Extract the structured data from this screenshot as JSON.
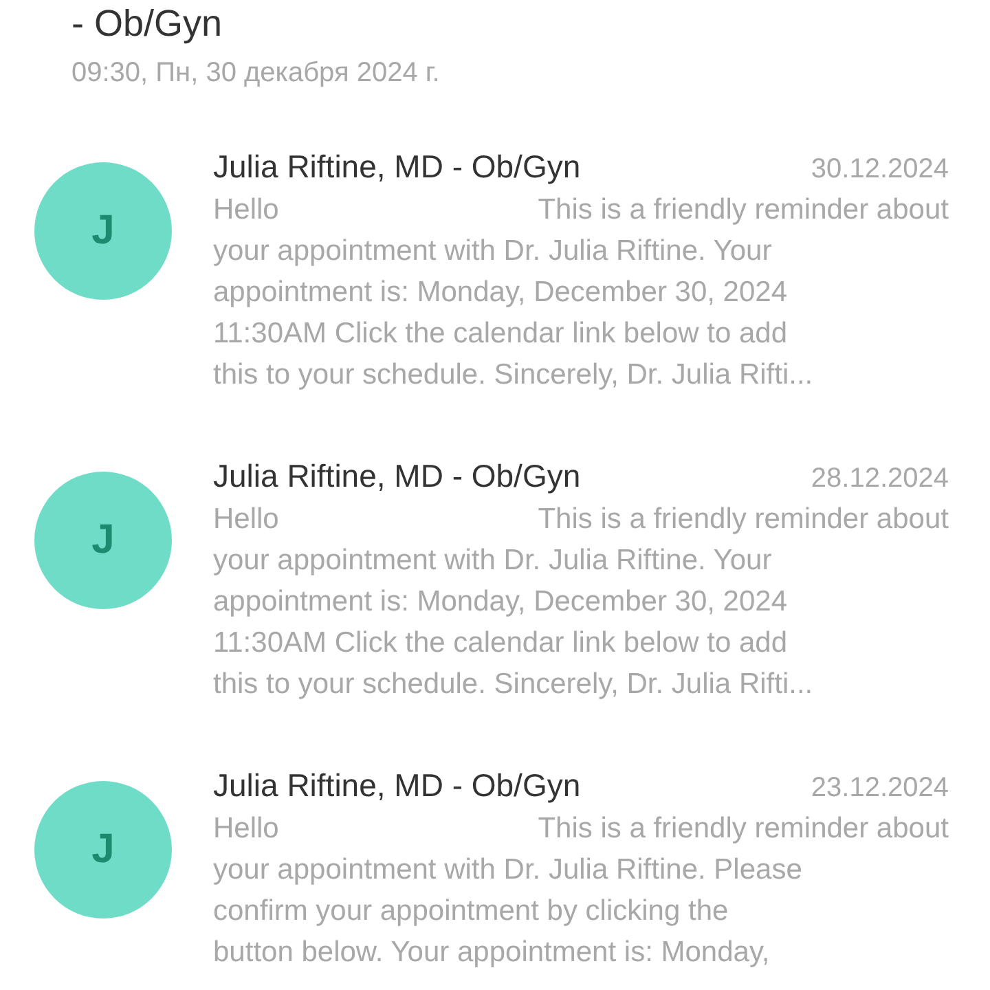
{
  "header": {
    "title": "- Ob/Gyn",
    "datetime": "09:30, Пн, 30 декабря 2024 г."
  },
  "messages": [
    {
      "avatar": "J",
      "sender": "Julia Riftine, MD - Ob/Gyn",
      "date": "30.12.2024",
      "greeting": "Hello",
      "lines": [
        "This is a friendly reminder about",
        "your appointment with Dr. Julia Riftine. Your",
        "appointment is: Monday, December 30, 2024",
        "11:30AM Click the calendar link below to add",
        "this to your schedule. Sincerely, Dr. Julia Rifti..."
      ]
    },
    {
      "avatar": "J",
      "sender": "Julia Riftine, MD - Ob/Gyn",
      "date": "28.12.2024",
      "greeting": "Hello",
      "lines": [
        "This is a friendly reminder about",
        "your appointment with Dr. Julia Riftine. Your",
        "appointment is: Monday, December 30, 2024",
        "11:30AM Click the calendar link below to add",
        "this to your schedule. Sincerely, Dr. Julia Rifti..."
      ]
    },
    {
      "avatar": "J",
      "sender": "Julia Riftine, MD - Ob/Gyn",
      "date": "23.12.2024",
      "greeting": "Hello",
      "lines": [
        "This is a friendly reminder about",
        "your appointment with Dr. Julia Riftine. Please",
        "confirm your appointment by clicking the",
        "button below. Your appointment is: Monday,"
      ]
    }
  ]
}
